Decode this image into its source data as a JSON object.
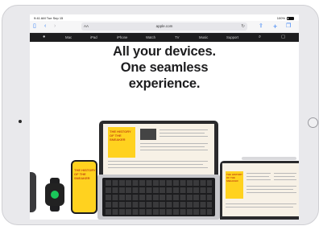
{
  "status_bar": {
    "time": "9:41 AM",
    "date": "Tue Sep 15",
    "battery": "100%"
  },
  "browser": {
    "text_size_label": "AA",
    "url": "apple.com",
    "icons": [
      "sidebar-icon",
      "back-icon",
      "forward-icon",
      "reload-icon",
      "share-icon",
      "new-tab-icon",
      "tabs-icon"
    ]
  },
  "global_nav": {
    "items": [
      "Mac",
      "iPad",
      "iPhone",
      "Watch",
      "TV",
      "Music",
      "Support"
    ],
    "icons": [
      "apple-logo-icon",
      "search-icon",
      "bag-icon"
    ]
  },
  "hero": {
    "line1": "All your devices.",
    "line2": "One seamless",
    "line3": "experience."
  },
  "devices_art": {
    "macbook_headline": "THE HISTORY OF THE SNEAKER",
    "iphone_headline": "THE HISTORY OF THE SNEAKER",
    "ipad_headline": "THE HISTORY OF THE SNEAKER"
  },
  "colors": {
    "nav_bg": "#1d1d1f",
    "accent": "#2f7cf6",
    "yellow": "#ffd21f",
    "watch_green": "#1ac85a"
  }
}
